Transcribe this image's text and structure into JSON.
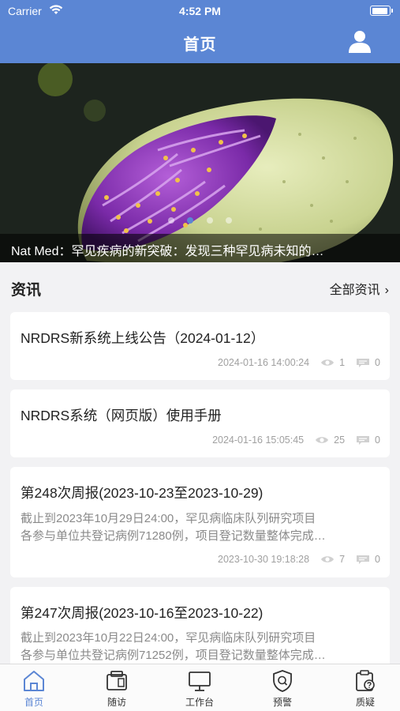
{
  "status_bar": {
    "carrier": "Carrier",
    "time": "4:52 PM"
  },
  "header": {
    "title": "首页"
  },
  "banner": {
    "caption": "Nat Med：罕见疾病的新突破：发现三种罕见病未知的…",
    "slide_count": 4,
    "active_slide": 2
  },
  "news": {
    "title": "资讯",
    "more_label": "全部资讯",
    "items": [
      {
        "title": "NRDRS新系统上线公告（2024-01-12）",
        "date": "2024-01-16 14:00:24",
        "views": "1",
        "comments": "0"
      },
      {
        "title": "NRDRS系统（网页版）使用手册",
        "date": "2024-01-16 15:05:45",
        "views": "25",
        "comments": "0"
      },
      {
        "title": "第248次周报(2023-10-23至2023-10-29)",
        "excerpt_1": "截止到2023年10月29日24:00，罕见病临床队列研究项目",
        "excerpt_2": "各参与单位共登记病例71280例，项目登记数量整体完成…",
        "date": "2023-10-30 19:18:28",
        "views": "7",
        "comments": "0"
      },
      {
        "title": "第247次周报(2023-10-16至2023-10-22)",
        "excerpt_1": "截止到2023年10月22日24:00，罕见病临床队列研究项目",
        "excerpt_2": "各参与单位共登记病例71252例，项目登记数量整体完成…"
      }
    ]
  },
  "tabs": [
    {
      "label": "首页",
      "icon": "home-icon",
      "active": true
    },
    {
      "label": "随访",
      "icon": "folder-icon"
    },
    {
      "label": "工作台",
      "icon": "monitor-icon"
    },
    {
      "label": "预警",
      "icon": "shield-alert-icon"
    },
    {
      "label": "质疑",
      "icon": "clipboard-question-icon"
    }
  ],
  "colors": {
    "primary": "#5b86d4",
    "background": "#f2f2f4",
    "muted": "#8a8a8a"
  }
}
